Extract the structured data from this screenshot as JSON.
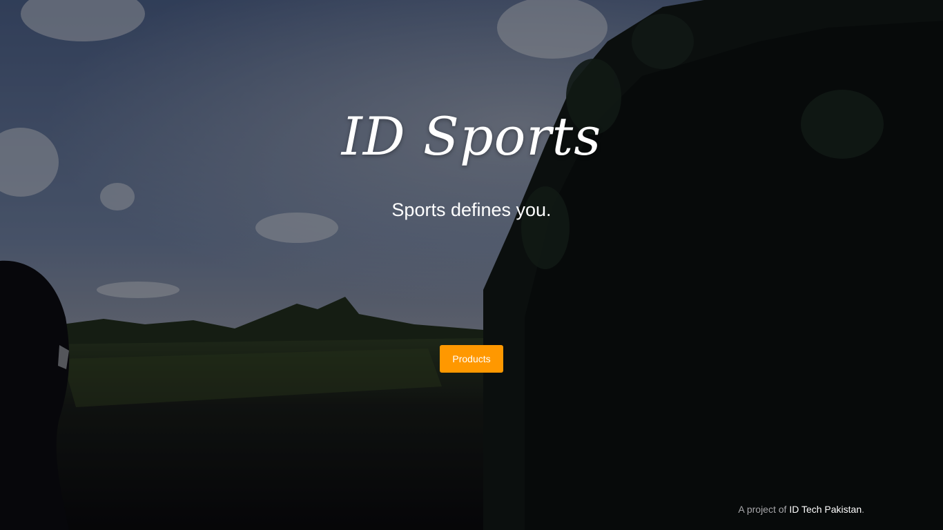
{
  "hero": {
    "title": "ID Sports",
    "tagline": "Sports defines you."
  },
  "cta": {
    "label": "Products"
  },
  "footer": {
    "prefix": "A project of ",
    "link_text": "ID Tech Pakistan",
    "suffix": "."
  },
  "colors": {
    "accent": "#ff9800",
    "text": "#ffffff",
    "footer_muted": "#a7a7aa"
  }
}
